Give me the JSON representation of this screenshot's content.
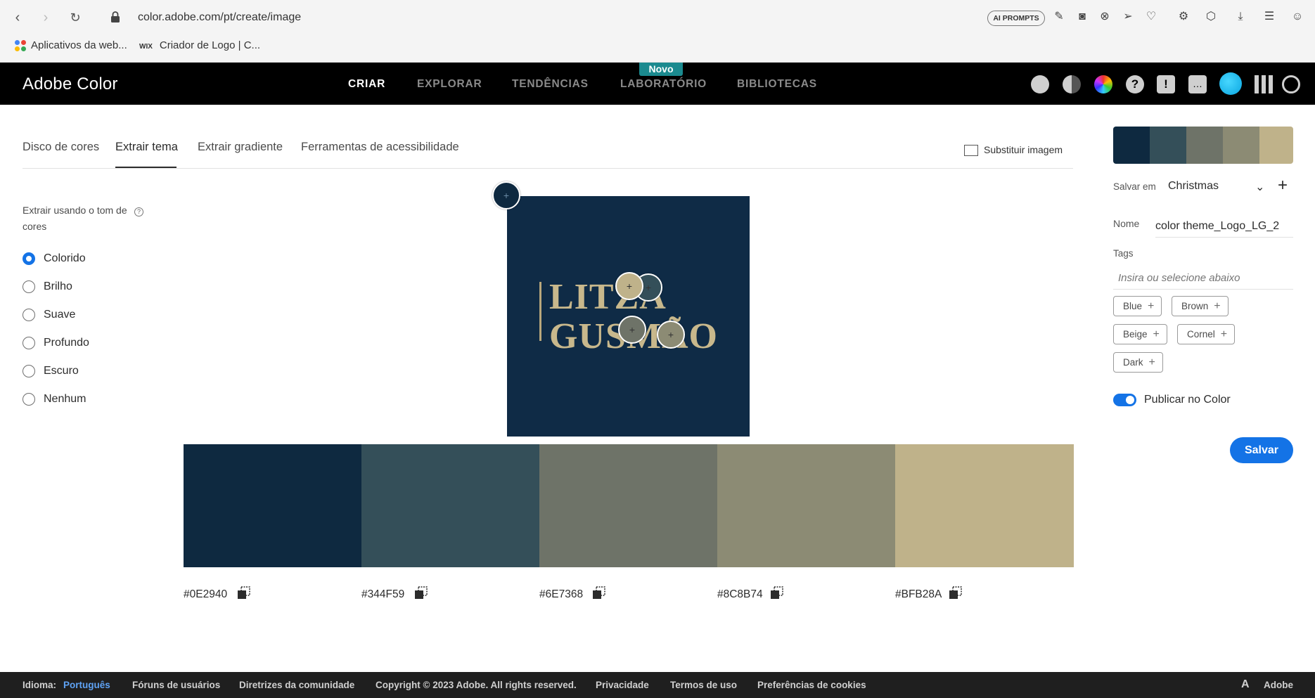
{
  "browser": {
    "url": "color.adobe.com/pt/create/image",
    "ai_prompts": "AI PROMPTS",
    "bookmarks": [
      "Aplicativos da web...",
      "Criador de Logo | C..."
    ],
    "wix_badge": "WIX"
  },
  "header": {
    "brand": "Adobe Color",
    "nav": [
      "CRIAR",
      "EXPLORAR",
      "TENDÊNCIAS",
      "LABORATÓRIO",
      "BIBLIOTECAS"
    ],
    "badge": "Novo"
  },
  "tabs": {
    "items": [
      "Disco de cores",
      "Extrair tema",
      "Extrair gradiente",
      "Ferramentas de acessibilidade"
    ],
    "active": "Extrair tema",
    "replace_image": "Substituir imagem"
  },
  "mood": {
    "label": "Extrair usando o tom de cores",
    "help": "?",
    "options": [
      "Colorido",
      "Brilho",
      "Suave",
      "Profundo",
      "Escuro",
      "Nenhum"
    ],
    "selected": "Colorido"
  },
  "image": {
    "logo_line1": "LITZA",
    "logo_line2": "GUSMÃO"
  },
  "palette": {
    "colors": [
      "#0E2940",
      "#344F59",
      "#6E7368",
      "#8C8B74",
      "#BFB28A"
    ],
    "hex_labels": [
      "#0E2940",
      "#344F59",
      "#6E7368",
      "#8C8B74",
      "#BFB28A"
    ]
  },
  "panel": {
    "save_in_label": "Salvar em",
    "library": "Christmas",
    "name_label": "Nome",
    "name_value": "color theme_Logo_LG_2",
    "tags_label": "Tags",
    "tags_placeholder": "Insira ou selecione abaixo",
    "tags": [
      "Blue",
      "Brown",
      "Beige",
      "Cornel",
      "Dark"
    ],
    "publish_label": "Publicar no Color",
    "publish_on": true,
    "save_button": "Salvar"
  },
  "footer": {
    "lang_label": "Idioma:",
    "lang_value": "Português",
    "links": [
      "Fóruns de usuários",
      "Diretrizes da comunidade",
      "Copyright © 2023 Adobe. All rights reserved.",
      "Privacidade",
      "Termos de uso",
      "Preferências de cookies"
    ],
    "adobe": "Adobe"
  }
}
